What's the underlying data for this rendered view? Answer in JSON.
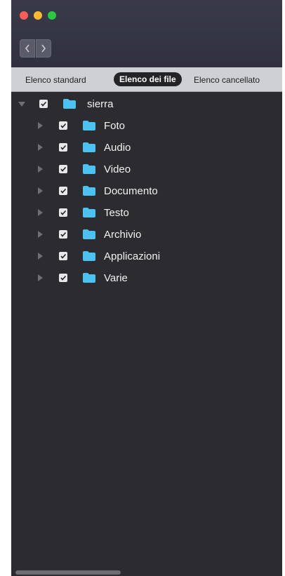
{
  "window": {
    "traffic_lights": [
      "close",
      "minimize",
      "zoom"
    ],
    "accent_colors": {
      "red": "#fd5d55",
      "yellow": "#fdba2d",
      "green": "#27c93f",
      "folder": "#4cc2f0"
    }
  },
  "nav": {
    "back_icon": "chevron-left-icon",
    "forward_icon": "chevron-right-icon"
  },
  "tabs": [
    {
      "label": "Elenco standard",
      "selected": false
    },
    {
      "label": "Elenco dei file",
      "selected": true
    },
    {
      "label": "Elenco cancellato",
      "selected": false
    }
  ],
  "tree": {
    "root": {
      "label": "sierra",
      "checked": true,
      "expanded": true
    },
    "children": [
      {
        "label": "Foto",
        "checked": true
      },
      {
        "label": "Audio",
        "checked": true
      },
      {
        "label": "Video",
        "checked": true
      },
      {
        "label": "Documento",
        "checked": true
      },
      {
        "label": "Testo",
        "checked": true
      },
      {
        "label": "Archivio",
        "checked": true
      },
      {
        "label": "Applicazioni",
        "checked": true
      },
      {
        "label": "Varie",
        "checked": true
      }
    ]
  }
}
